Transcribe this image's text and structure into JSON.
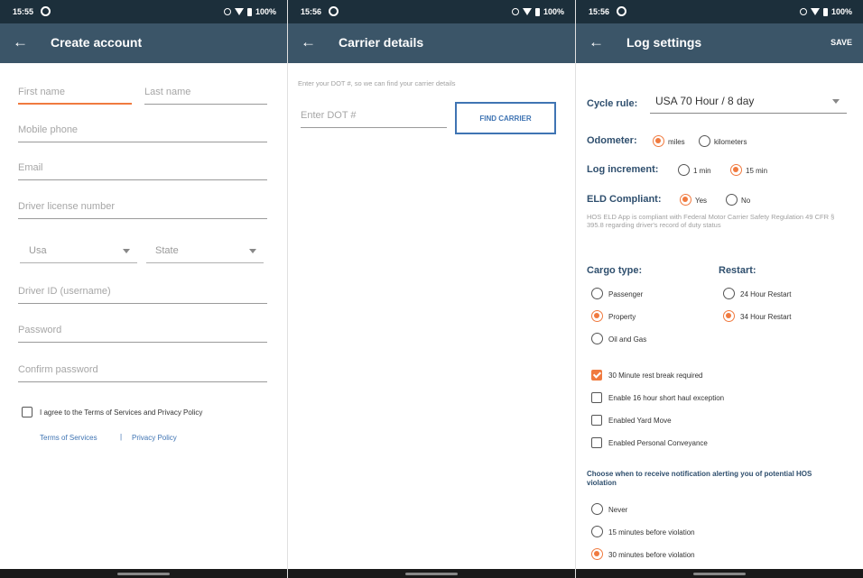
{
  "status": {
    "screen1_time": "15:55",
    "screen2_time": "15:56",
    "screen3_time": "15:56",
    "battery": "100%"
  },
  "create_account": {
    "title": "Create account",
    "first_name": "First name",
    "last_name": "Last name",
    "mobile_phone": "Mobile phone",
    "email": "Email",
    "driver_license": "Driver license number",
    "country": "Usa",
    "state": "State",
    "driver_id": "Driver ID (username)",
    "password": "Password",
    "confirm_password": "Confirm password",
    "agree_text": "I agree to the Terms of Services and Privacy Policy",
    "terms_link": "Terms of Services",
    "separator": "|",
    "privacy_link": "Privacy Policy"
  },
  "carrier_details": {
    "title": "Carrier details",
    "instruction": "Enter your DOT #, so we can find your carrier details",
    "dot_placeholder": "Enter DOT #",
    "find_button": "FIND CARRIER"
  },
  "log_settings": {
    "title": "Log settings",
    "save": "SAVE",
    "cycle_rule_label": "Cycle rule:",
    "cycle_rule_value": "USA 70 Hour / 8 day",
    "odometer_label": "Odometer:",
    "odometer_miles": "miles",
    "odometer_km": "kilometers",
    "log_increment_label": "Log increment:",
    "log_increment_1": "1 min",
    "log_increment_15": "15 min",
    "eld_label": "ELD Compliant:",
    "eld_yes": "Yes",
    "eld_no": "No",
    "eld_hint": "HOS ELD App is compliant with Federal Motor Carrier Safety Regulation 49 CFR § 395.8 regarding driver's record of duty status",
    "cargo_label": "Cargo type:",
    "cargo_passenger": "Passenger",
    "cargo_property": "Property",
    "cargo_oil": "Oil and Gas",
    "restart_label": "Restart:",
    "restart_24": "24 Hour Restart",
    "restart_34": "34 Hour Restart",
    "check_rest": "30 Minute rest break required",
    "check_16": "Enable 16 hour short haul exception",
    "check_yard": "Enabled Yard Move",
    "check_personal": "Enabled Personal Conveyance",
    "notify_label": "Choose when to receive notification alerting you of potential HOS violation",
    "notify_never": "Never",
    "notify_15": "15 minutes before violation",
    "notify_30": "30 minutes before violation"
  },
  "colors": {
    "status_bar": "#1c2f3b",
    "app_bar": "#3b5568",
    "accent": "#f07a3f",
    "link": "#3f74b3",
    "label": "#2f4f6e"
  },
  "icons": [
    "back-arrow-icon",
    "g-icon",
    "wifi-icon",
    "battery-icon",
    "chevron-down-icon"
  ]
}
